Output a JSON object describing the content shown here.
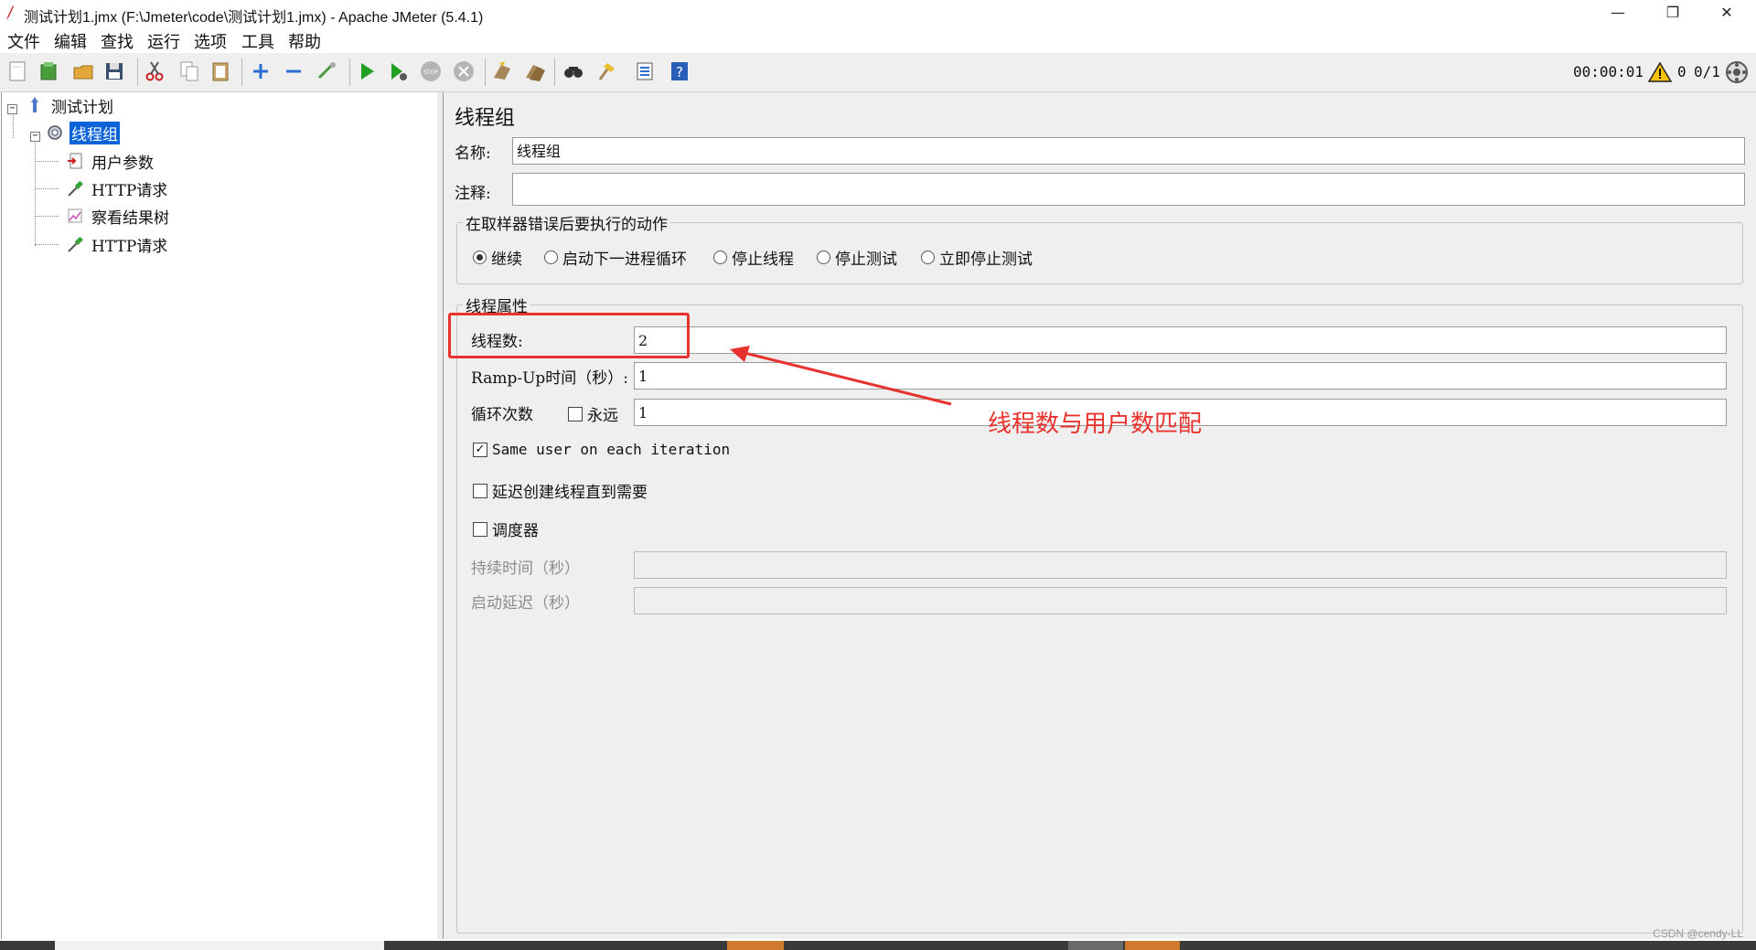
{
  "window": {
    "title": "测试计划1.jmx (F:\\Jmeter\\code\\测试计划1.jmx) - Apache JMeter (5.4.1)",
    "minimize_glyph": "—",
    "restore_glyph": "❐",
    "close_glyph": "✕"
  },
  "menu": [
    "文件",
    "编辑",
    "查找",
    "运行",
    "选项",
    "工具",
    "帮助"
  ],
  "toolbar": {
    "icons": [
      "new-icon",
      "templates-icon",
      "open-icon",
      "save-icon",
      "cut-icon",
      "copy-icon",
      "paste-icon",
      "expand-icon",
      "collapse-icon",
      "toggle-icon",
      "start-icon",
      "start-no-pause-icon",
      "stop-icon",
      "shutdown-icon",
      "clear-icon",
      "clear-all-icon",
      "search-icon",
      "reset-search-icon",
      "function-helper-icon",
      "help-icon"
    ],
    "timer": "00:00:01",
    "warning_count": "0",
    "thread_count": "0/1"
  },
  "tree": {
    "root": "测试计划",
    "thread_group": "线程组",
    "children": [
      "用户参数",
      "HTTP请求",
      "察看结果树",
      "HTTP请求"
    ]
  },
  "panel": {
    "title": "线程组",
    "name_label": "名称:",
    "name_value": "线程组",
    "comment_label": "注释:",
    "comment_value": "",
    "error_action_legend": "在取样器错误后要执行的动作",
    "error_actions": [
      {
        "label": "继续",
        "selected": true
      },
      {
        "label": "启动下一进程循环",
        "selected": false
      },
      {
        "label": "停止线程",
        "selected": false
      },
      {
        "label": "停止测试",
        "selected": false
      },
      {
        "label": "立即停止测试",
        "selected": false
      }
    ],
    "thread_props_legend": "线程属性",
    "threads_label": "线程数:",
    "threads_value": "2",
    "rampup_label": "Ramp-Up时间（秒）:",
    "rampup_value": "1",
    "loop_label": "循环次数",
    "forever_label": "永远",
    "forever_checked": false,
    "loop_value": "1",
    "same_user_label": "Same user on each iteration",
    "same_user_checked": true,
    "delay_label": "延迟创建线程直到需要",
    "delay_checked": false,
    "scheduler_label": "调度器",
    "scheduler_checked": false,
    "duration_label": "持续时间（秒）",
    "duration_value": "",
    "startup_delay_label": "启动延迟（秒）",
    "startup_delay_value": ""
  },
  "annotation": {
    "text": "线程数与用户数匹配",
    "color": "#e8322e"
  },
  "watermark": "CSDN @cendy-LL",
  "colors": {
    "selection": "#0a63d8",
    "annotation_red": "#e8322e"
  }
}
